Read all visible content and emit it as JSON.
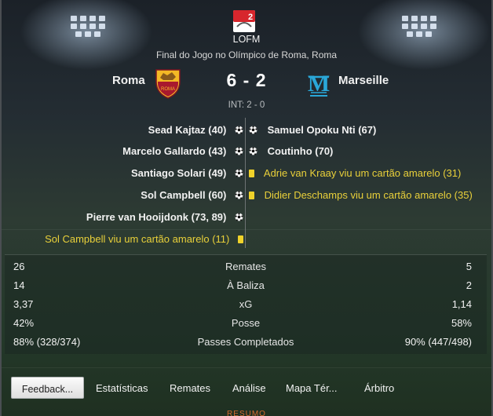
{
  "competition": {
    "logo_text": "2",
    "name": "LOFM"
  },
  "venue": "Final do Jogo no Olímpico de Roma, Roma",
  "home_team": {
    "name": "Roma",
    "crest": "roma-crest-icon"
  },
  "away_team": {
    "name": "Marseille",
    "crest": "marseille-crest-icon"
  },
  "score": "6 - 2",
  "halftime": "INT: 2 - 0",
  "home_events": [
    {
      "text": "Sead Kajtaz (40)",
      "icon": "ball-icon"
    },
    {
      "text": "Marcelo Gallardo (43)",
      "icon": "ball-icon"
    },
    {
      "text": "Santiago Solari (49)",
      "icon": "ball-icon"
    },
    {
      "text": "Sol Campbell (60)",
      "icon": "ball-icon"
    },
    {
      "text": "Pierre van Hooijdonk (73, 89)",
      "icon": "ball-icon"
    },
    {
      "text": "Sol Campbell viu um cartão amarelo (11)",
      "icon": "yellow-card-icon"
    }
  ],
  "away_events": [
    {
      "text": "Samuel Opoku Nti (67)",
      "icon": "ball-icon"
    },
    {
      "text": "Coutinho (70)",
      "icon": "ball-icon"
    },
    {
      "text": "Adrie van Kraay viu um cartão amarelo (31)",
      "icon": "yellow-card-icon"
    },
    {
      "text": "Didier Deschamps viu um cartão amarelo (35)",
      "icon": "yellow-card-icon"
    }
  ],
  "stats": [
    {
      "label": "Remates",
      "home": "26",
      "away": "5"
    },
    {
      "label": "À Baliza",
      "home": "14",
      "away": "2"
    },
    {
      "label": "xG",
      "home": "3,37",
      "away": "1,14"
    },
    {
      "label": "Posse",
      "home": "42%",
      "away": "58%"
    },
    {
      "label": "Passes Completados",
      "home": "88% (328/374)",
      "away": "90% (447/498)"
    }
  ],
  "buttons": {
    "feedback": "Feedback...",
    "tabs": [
      "Estatísticas",
      "Remates",
      "Análise",
      "Mapa Tér...",
      "Árbitro"
    ],
    "summary": "RESUMO"
  },
  "colors": {
    "card_text": "#e9d03a",
    "yellow_card": "#f0d22a",
    "summary": "#d2692e"
  }
}
